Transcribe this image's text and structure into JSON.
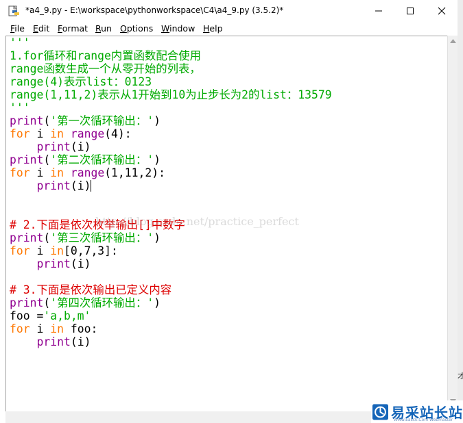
{
  "window": {
    "title": "*a4_9.py - E:\\workspace\\pythonworkspace\\C4\\a4_9.py (3.5.2)*",
    "controls": [
      "minimize",
      "maximize",
      "close"
    ]
  },
  "menu": [
    {
      "label": "File",
      "key": "F",
      "rest": "ile"
    },
    {
      "label": "Edit",
      "key": "E",
      "rest": "dit"
    },
    {
      "label": "Format",
      "key": "F",
      "rest": "ormat"
    },
    {
      "label": "Run",
      "key": "R",
      "rest": "un"
    },
    {
      "label": "Options",
      "key": "O",
      "rest": "ptions"
    },
    {
      "label": "Window",
      "key": "W",
      "rest": "indow"
    },
    {
      "label": "Help",
      "key": "H",
      "rest": "elp"
    }
  ],
  "code_lines": [
    [
      {
        "t": "'''",
        "c": "str"
      }
    ],
    [
      {
        "t": "1.for循环和range内置函数配合使用",
        "c": "str"
      }
    ],
    [
      {
        "t": "range函数生成一个从零开始的列表，",
        "c": "str"
      }
    ],
    [
      {
        "t": "range(4)表示list：0123",
        "c": "str"
      }
    ],
    [
      {
        "t": "range(1,11,2)表示从1开始到10为止步长为2的list：13579",
        "c": "str"
      }
    ],
    [
      {
        "t": "'''",
        "c": "str"
      }
    ],
    [
      {
        "t": "print",
        "c": "bi"
      },
      {
        "t": "(",
        "c": ""
      },
      {
        "t": "'第一次循环输出：'",
        "c": "str"
      },
      {
        "t": ")",
        "c": ""
      }
    ],
    [
      {
        "t": "for",
        "c": "kw"
      },
      {
        "t": " i ",
        "c": ""
      },
      {
        "t": "in",
        "c": "kw"
      },
      {
        "t": " ",
        "c": ""
      },
      {
        "t": "range",
        "c": "bi"
      },
      {
        "t": "(4):",
        "c": ""
      }
    ],
    [
      {
        "t": "    ",
        "c": ""
      },
      {
        "t": "print",
        "c": "bi"
      },
      {
        "t": "(i)",
        "c": ""
      }
    ],
    [
      {
        "t": "print",
        "c": "bi"
      },
      {
        "t": "(",
        "c": ""
      },
      {
        "t": "'第二次循环输出：'",
        "c": "str"
      },
      {
        "t": ")",
        "c": ""
      }
    ],
    [
      {
        "t": "for",
        "c": "kw"
      },
      {
        "t": " i ",
        "c": ""
      },
      {
        "t": "in",
        "c": "kw"
      },
      {
        "t": " ",
        "c": ""
      },
      {
        "t": "range",
        "c": "bi"
      },
      {
        "t": "(1,11,2):",
        "c": ""
      }
    ],
    [
      {
        "t": "    ",
        "c": ""
      },
      {
        "t": "print",
        "c": "bi"
      },
      {
        "t": "(i)",
        "c": ""
      },
      {
        "t": "",
        "c": "cursor"
      }
    ],
    [],
    [],
    [
      {
        "t": "# 2.下面是依次枚举输出[]中数字",
        "c": "cmt"
      }
    ],
    [
      {
        "t": "print",
        "c": "bi"
      },
      {
        "t": "(",
        "c": ""
      },
      {
        "t": "'第三次循环输出：'",
        "c": "str"
      },
      {
        "t": ")",
        "c": ""
      }
    ],
    [
      {
        "t": "for",
        "c": "kw"
      },
      {
        "t": " i ",
        "c": ""
      },
      {
        "t": "in",
        "c": "kw"
      },
      {
        "t": "[0,7,3]:",
        "c": ""
      }
    ],
    [
      {
        "t": "    ",
        "c": ""
      },
      {
        "t": "print",
        "c": "bi"
      },
      {
        "t": "(i)",
        "c": ""
      }
    ],
    [],
    [
      {
        "t": "# 3.下面是依次输出已定义内容",
        "c": "cmt"
      }
    ],
    [
      {
        "t": "print",
        "c": "bi"
      },
      {
        "t": "(",
        "c": ""
      },
      {
        "t": "'第四次循环输出：'",
        "c": "str"
      },
      {
        "t": ")",
        "c": ""
      }
    ],
    [
      {
        "t": "foo =",
        "c": ""
      },
      {
        "t": "'a,b,m'",
        "c": "str"
      }
    ],
    [
      {
        "t": "for",
        "c": "kw"
      },
      {
        "t": " i ",
        "c": ""
      },
      {
        "t": "in",
        "c": "kw"
      },
      {
        "t": " foo:",
        "c": ""
      }
    ],
    [
      {
        "t": "    ",
        "c": ""
      },
      {
        "t": "print",
        "c": "bi"
      },
      {
        "t": "(i)",
        "c": ""
      }
    ]
  ],
  "watermark": "http://blog.csdn.net/practice_perfect",
  "right_edge_glyph": "才",
  "logo": {
    "text": "易采站长站",
    "sub": "Www.Easck.Com Webmaster"
  },
  "colors": {
    "string": "#00aa00",
    "keyword": "#ff7700",
    "builtin": "#900090",
    "comment": "#dd0000",
    "logo": "#1565b8"
  }
}
